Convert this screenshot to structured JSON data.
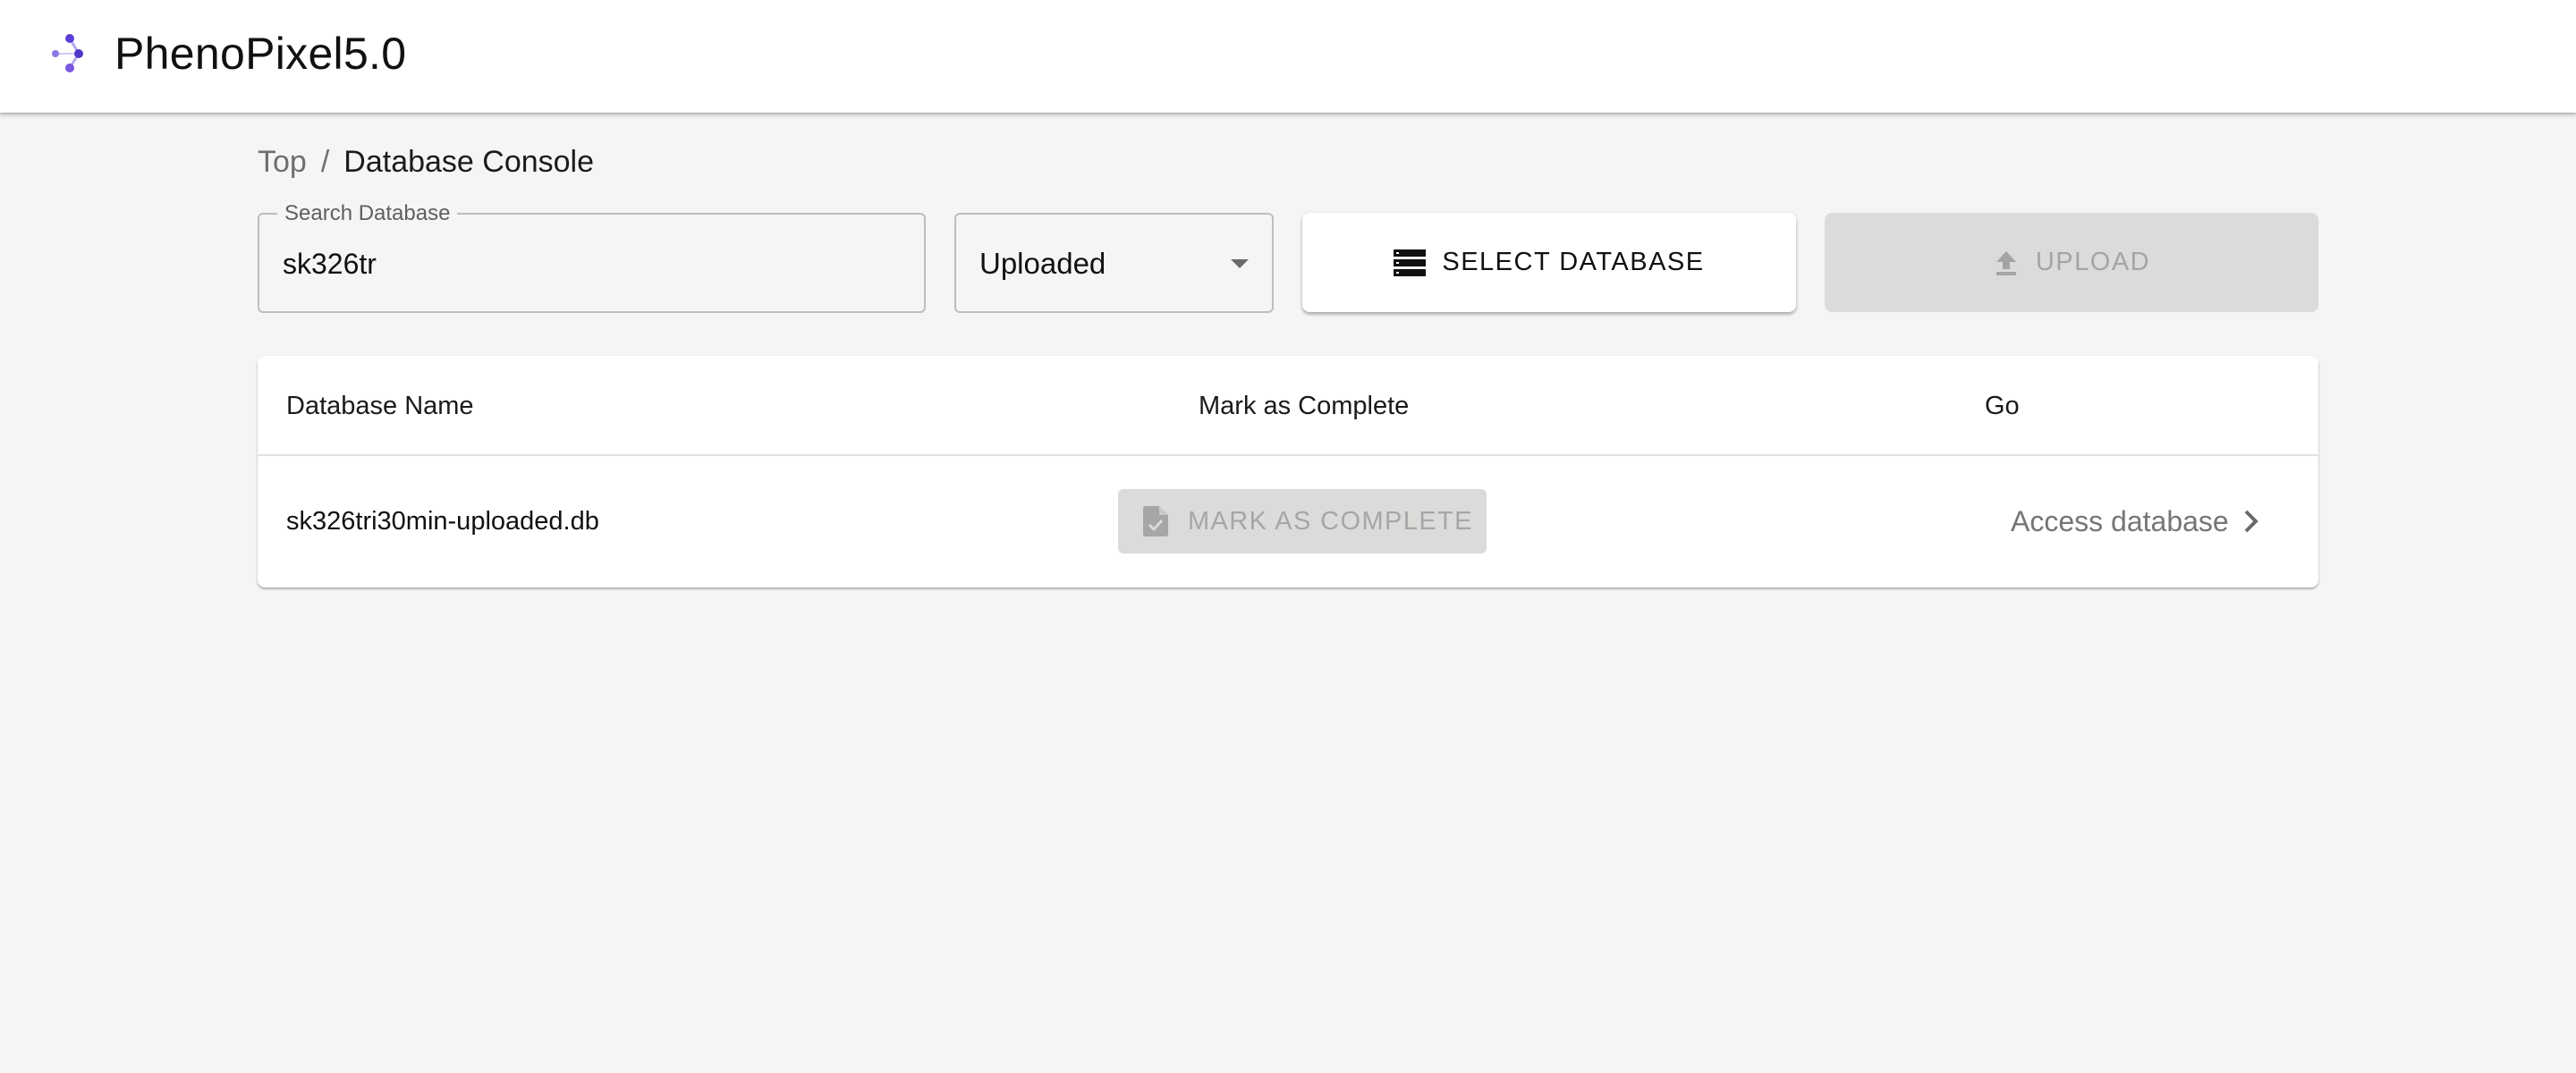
{
  "header": {
    "title": "PhenoPixel5.0",
    "logo_icon": "molecule-logo-icon",
    "accent_color": "#5b3fd6"
  },
  "breadcrumb": {
    "items": [
      "Top",
      "Database Console"
    ],
    "separator": "/"
  },
  "search": {
    "label": "Search Database",
    "value": "sk326tr"
  },
  "status_filter": {
    "selected": "Uploaded"
  },
  "toolbar": {
    "select_database_label": "SELECT DATABASE",
    "select_database_icon": "database-list-icon",
    "upload_label": "UPLOAD",
    "upload_icon": "upload-arrow-icon",
    "upload_disabled": true
  },
  "table": {
    "columns": [
      "Database Name",
      "Mark as Complete",
      "Go"
    ],
    "rows": [
      {
        "name": "sk326tri30min-uploaded.db",
        "mark_label": "MARK AS COMPLETE",
        "mark_disabled": true,
        "go_label": "Access database"
      }
    ]
  }
}
